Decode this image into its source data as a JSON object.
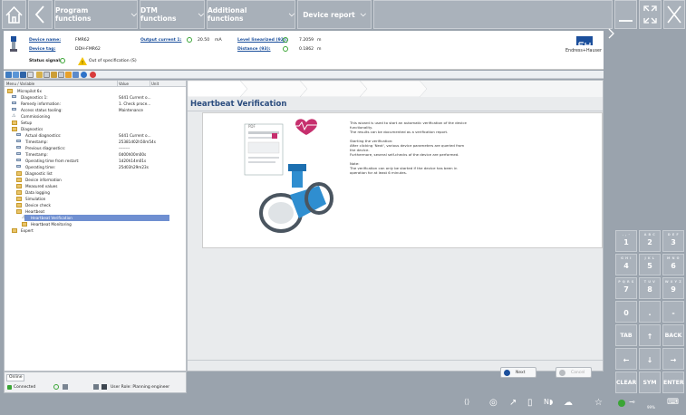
{
  "top_menu": [
    {
      "label": "Program functions"
    },
    {
      "label": "DTM functions"
    },
    {
      "label": "Additional functions"
    },
    {
      "label": "Device report"
    }
  ],
  "header": {
    "device_name_label": "Device name:",
    "device_name_value": "FMR62",
    "device_tag_label": "Device tag:",
    "device_tag_value": "DDH-FMR62",
    "status_label": "Status signal:",
    "status_value": "Out of specification (S)",
    "output_current_label": "Output current 1:",
    "output_current_value": "20.50",
    "output_current_unit": "mA",
    "level_label": "Level linearized (92):",
    "level_value": "7.2059",
    "level_unit": "m",
    "distance_label": "Distance (93):",
    "distance_value": "0.1862",
    "distance_unit": "m",
    "brand": "Endress+Hauser"
  },
  "tree": {
    "col_menu": "Menu / Variable",
    "col_value": "Value",
    "col_unit": "Unit",
    "rows": [
      {
        "label": "Micropilot 6x",
        "value": ""
      },
      {
        "label": "Diagnostics 1:",
        "value": "S441 Current o..."
      },
      {
        "label": "Remedy information:",
        "value": "1. Check proce..."
      },
      {
        "label": "Access status tooling:",
        "value": "Maintenance"
      },
      {
        "label": "Commissioning",
        "value": ""
      },
      {
        "label": "Setup",
        "value": ""
      },
      {
        "label": "Diagnostics",
        "value": ""
      },
      {
        "label": "Actual diagnostics:",
        "value": "S441 Current o..."
      },
      {
        "label": "Timestamp:",
        "value": "25381d02h50m54s"
      },
      {
        "label": "Previous diagnostics:",
        "value": "--------"
      },
      {
        "label": "Timestamp:",
        "value": "0d00h00m00s"
      },
      {
        "label": "Operating time from restart:",
        "value": "1d20h14m01s"
      },
      {
        "label": "Operating time:",
        "value": "25d03h29m23s"
      },
      {
        "label": "Diagnostic list",
        "value": ""
      },
      {
        "label": "Device information",
        "value": ""
      },
      {
        "label": "Measured values",
        "value": ""
      },
      {
        "label": "Data logging",
        "value": ""
      },
      {
        "label": "Simulation",
        "value": ""
      },
      {
        "label": "Device check",
        "value": ""
      },
      {
        "label": "Heartbeat",
        "value": ""
      },
      {
        "label": "Heartbeat Verification",
        "value": ""
      },
      {
        "label": "Heartbeat Monitoring",
        "value": ""
      },
      {
        "label": "Expert",
        "value": ""
      }
    ]
  },
  "status": {
    "tab": "Online",
    "connected": "Connected",
    "user_role": "User Role: Planning engineer"
  },
  "main": {
    "title": "Heartbeat Verification",
    "pdf_label": "PDF",
    "text1": "This wizard is used to start an automatic verification of the device functionality.",
    "text2": "The results can be documented as a verification report.",
    "text3": "Starting the verification:",
    "text4": "After clicking 'Next', various device parameters are queried from the device.",
    "text5": "Furthermore, several self-checks of the device are performed.",
    "text6": "Note:",
    "text7": "The verification can only be started if the device has been in operation for at least 6 minutes.",
    "next_label": "Next",
    "cancel_label": "Cancel"
  },
  "keypad": {
    "keys": [
      {
        "sub": ". , -",
        "main": "1"
      },
      {
        "sub": "A B C",
        "main": "2"
      },
      {
        "sub": "D E F",
        "main": "3"
      },
      {
        "sub": "G H I",
        "main": "4"
      },
      {
        "sub": "J K L",
        "main": "5"
      },
      {
        "sub": "M N O",
        "main": "6"
      },
      {
        "sub": "P Q R S",
        "main": "7"
      },
      {
        "sub": "T U V",
        "main": "8"
      },
      {
        "sub": "W X Y Z",
        "main": "9"
      },
      {
        "sub": "",
        "main": "0"
      },
      {
        "sub": "",
        "main": "."
      },
      {
        "sub": "",
        "main": "-"
      },
      {
        "sub": "",
        "main": "TAB"
      },
      {
        "sub": "",
        "main": "↑"
      },
      {
        "sub": "",
        "main": "BACK"
      },
      {
        "sub": "",
        "main": "←"
      },
      {
        "sub": "",
        "main": "↓"
      },
      {
        "sub": "",
        "main": "→"
      },
      {
        "sub": "",
        "main": "CLEAR"
      },
      {
        "sub": "",
        "main": "SYM"
      },
      {
        "sub": "",
        "main": "ENTER"
      }
    ]
  },
  "tray": {
    "battery": "99%",
    "colors": {
      "accent": "#1b4f9c",
      "ok": "#3aa535",
      "bar": "#9aa3ad"
    }
  }
}
